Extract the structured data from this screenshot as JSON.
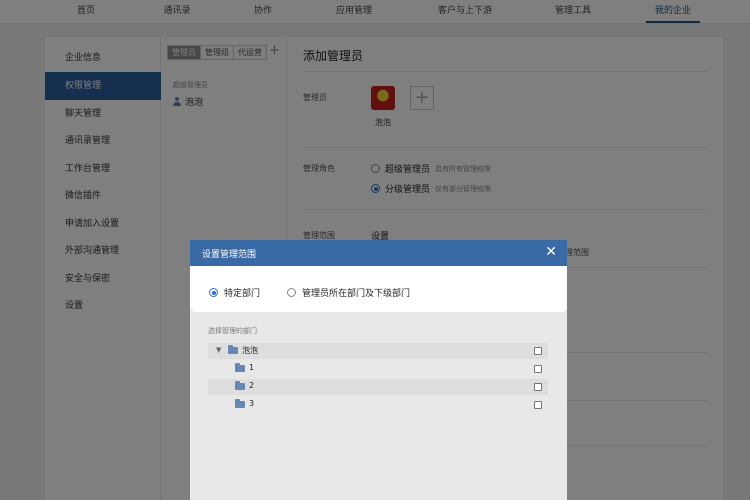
{
  "topnav": {
    "tabs": [
      "首页",
      "通讯录",
      "协作",
      "应用管理",
      "客户与上下游",
      "管理工具",
      "我的企业"
    ]
  },
  "sidebar": {
    "items": [
      "企业信息",
      "权限管理",
      "聊天管理",
      "通讯录管理",
      "工作台管理",
      "微信插件",
      "申请加入设置",
      "外部沟通管理",
      "安全与保密",
      "设置"
    ]
  },
  "midpanel": {
    "segments": [
      "管理员",
      "管理组",
      "代运营"
    ],
    "add_symbol": "+",
    "section_label": "超级管理员",
    "user": "泡泡"
  },
  "content": {
    "title": "添加管理员",
    "admin_label": "管理员",
    "admin_name": "泡泡",
    "add_symbol": "+",
    "role_label": "管理角色",
    "role_super": "超级管理员",
    "role_super_desc": "具有所有管理权限",
    "role_sub": "分级管理员",
    "role_sub_desc": "仅有部分管理权限",
    "scope_label": "管理范围",
    "scope_set": "设置",
    "scope_tail": "理范围"
  },
  "modal": {
    "title": "设置管理范围",
    "close": "✕",
    "option_specific": "特定部门",
    "option_own": "管理员所在部门及下级部门",
    "section_label": "选择管理的部门",
    "tree": {
      "root": "泡泡",
      "children": [
        "1",
        "2",
        "3"
      ]
    }
  }
}
